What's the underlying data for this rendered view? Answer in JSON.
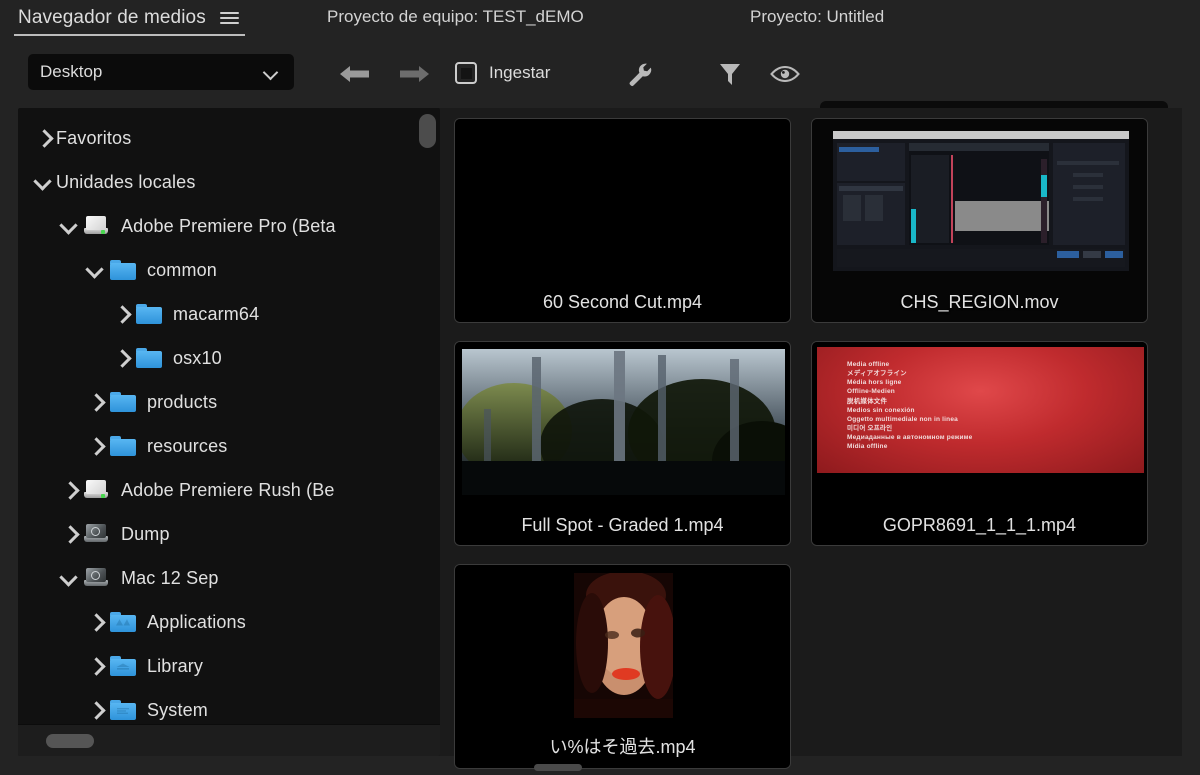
{
  "panel": {
    "tab_title": "Navegador de medios",
    "menu_icon": "hamburger-icon"
  },
  "header": {
    "team_project": "Proyecto de equipo: TEST_dEMO",
    "project": "Proyecto: Untitled"
  },
  "toolbar": {
    "location_value": "Desktop",
    "back_icon": "arrow-left-icon",
    "forward_icon": "arrow-right-icon",
    "ingest_label": "Ingestar",
    "ingest_checkbox_icon": "checkbox-icon",
    "wrench_icon": "wrench-icon",
    "filter_icon": "funnel-icon",
    "eye_icon": "eye-icon",
    "search_icon": "search-icon",
    "search_value": "",
    "search_placeholder": ""
  },
  "tree": {
    "items": [
      {
        "label": "Favoritos",
        "depth": 0,
        "state": "collapsed",
        "icon": "none"
      },
      {
        "label": "Unidades locales",
        "depth": 0,
        "state": "expanded",
        "icon": "none"
      },
      {
        "label": "Adobe Premiere Pro (Beta",
        "depth": 1,
        "state": "expanded",
        "icon": "drive-light-icon"
      },
      {
        "label": "common",
        "depth": 2,
        "state": "expanded",
        "icon": "folder-icon"
      },
      {
        "label": "macarm64",
        "depth": 3,
        "state": "collapsed",
        "icon": "folder-icon"
      },
      {
        "label": "osx10",
        "depth": 3,
        "state": "collapsed",
        "icon": "folder-icon"
      },
      {
        "label": "products",
        "depth": 2,
        "state": "collapsed",
        "icon": "folder-icon"
      },
      {
        "label": "resources",
        "depth": 2,
        "state": "collapsed",
        "icon": "folder-icon"
      },
      {
        "label": "Adobe Premiere Rush (Be",
        "depth": 1,
        "state": "collapsed",
        "icon": "drive-light-icon"
      },
      {
        "label": "Dump",
        "depth": 1,
        "state": "collapsed",
        "icon": "drive-dark-icon"
      },
      {
        "label": "Mac 12 Sep",
        "depth": 1,
        "state": "expanded",
        "icon": "drive-dark-icon"
      },
      {
        "label": "Applications",
        "depth": 2,
        "state": "collapsed",
        "icon": "folder-apps-icon"
      },
      {
        "label": "Library",
        "depth": 2,
        "state": "collapsed",
        "icon": "folder-library-icon"
      },
      {
        "label": "System",
        "depth": 2,
        "state": "collapsed",
        "icon": "folder-system-icon"
      }
    ]
  },
  "media": {
    "items": [
      {
        "name": "60 Second Cut.mp4",
        "thumb": "black"
      },
      {
        "name": "CHS_REGION.mov",
        "thumb": "editor-screenshot"
      },
      {
        "name": "Full Spot - Graded 1.mp4",
        "thumb": "forest"
      },
      {
        "name": "GOPR8691_1_1_1.mp4",
        "thumb": "media-offline"
      },
      {
        "name": "い%はそ過去.mp4",
        "thumb": "portrait"
      }
    ]
  },
  "media_offline": {
    "lines": [
      "Media offline",
      "メディアオフライン",
      "Média hors ligne",
      "Offline-Medien",
      "脱机媒体文件",
      "Medios sin conexión",
      "Oggetto multimediale non in linea",
      "미디어 오프라인",
      "Медиаданные в автономном режиме",
      "Mídia offline"
    ]
  },
  "colors": {
    "app_bg": "#232323",
    "panel_bg": "#1b1b1b",
    "tree_bg": "#111111",
    "folder_blue": "#3f9fe0",
    "offline_red": "#c02b2e",
    "text": "#dcdcdc"
  }
}
